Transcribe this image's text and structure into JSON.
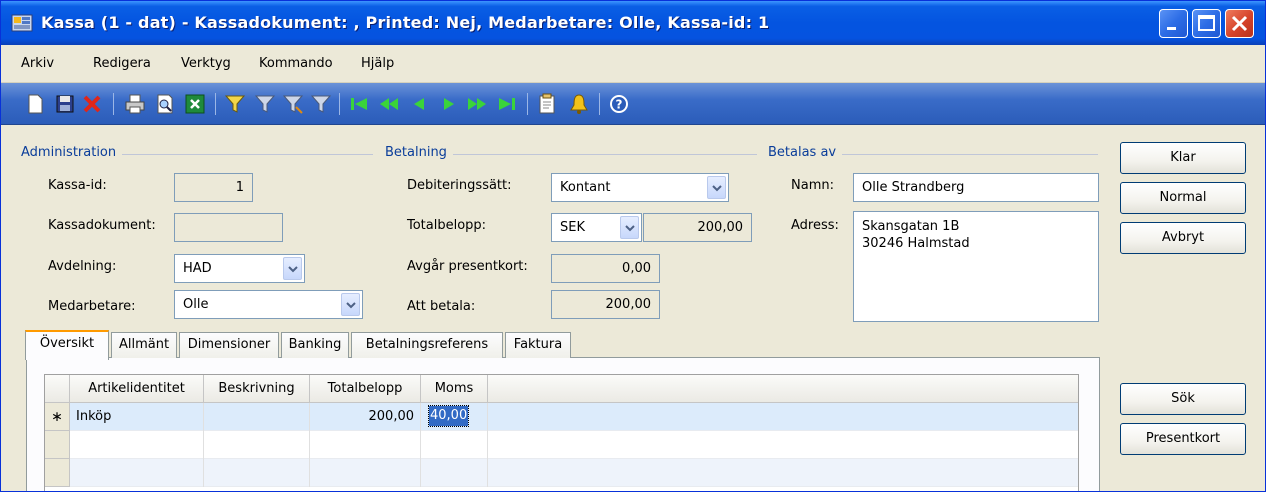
{
  "window": {
    "title": "Kassa (1 - dat) - Kassadokument: , Printed: Nej, Medarbetare: Olle, Kassa-id: 1"
  },
  "menu": [
    "Arkiv",
    "Redigera",
    "Verktyg",
    "Kommando",
    "Hjälp"
  ],
  "toolbar_icons": [
    "new-icon",
    "save-icon",
    "delete-icon",
    "print-icon",
    "print-preview-icon",
    "excel-icon",
    "filter-icon",
    "field-filter-icon",
    "flow-filter-icon",
    "clear-filter-icon",
    "first-record-icon",
    "previous-page-icon",
    "previous-record-icon",
    "next-record-icon",
    "next-page-icon",
    "last-record-icon",
    "comment-icon",
    "alert-icon",
    "help-icon"
  ],
  "administration": {
    "section": "Administration",
    "kassa_id_label": "Kassa-id:",
    "kassa_id_value": "1",
    "kassadokument_label": "Kassadokument:",
    "kassadokument_value": "",
    "avdelning_label": "Avdelning:",
    "avdelning_value": "HAD",
    "medarbetare_label": "Medarbetare:",
    "medarbetare_value": "Olle"
  },
  "betalning": {
    "section": "Betalning",
    "debitering_label": "Debiteringssätt:",
    "debitering_value": "Kontant",
    "totalbelopp_label": "Totalbelopp:",
    "currency": "SEK",
    "totalbelopp_value": "200,00",
    "presentkort_label": "Avgår presentkort:",
    "presentkort_value": "0,00",
    "att_betala_label": "Att betala:",
    "att_betala_value": "200,00"
  },
  "betalas_av": {
    "section": "Betalas av",
    "namn_label": "Namn:",
    "namn_value": "Olle Strandberg",
    "adress_label": "Adress:",
    "adress_line1": "Skansgatan 1B",
    "adress_line2": "30246 Halmstad"
  },
  "buttons": {
    "klar": "Klar",
    "normal": "Normal",
    "avbryt": "Avbryt",
    "sok": "Sök",
    "presentkort": "Presentkort"
  },
  "tabs": [
    "Översikt",
    "Allmänt",
    "Dimensioner",
    "Banking",
    "Betalningsreferens",
    "Faktura"
  ],
  "grid": {
    "columns": [
      "Artikelidentitet",
      "Beskrivning",
      "Totalbelopp",
      "Moms"
    ],
    "rows": [
      {
        "marker": "∗",
        "artikel": "Inköp",
        "beskrivning": "",
        "totalbelopp": "200,00",
        "moms": "40,00"
      }
    ]
  }
}
